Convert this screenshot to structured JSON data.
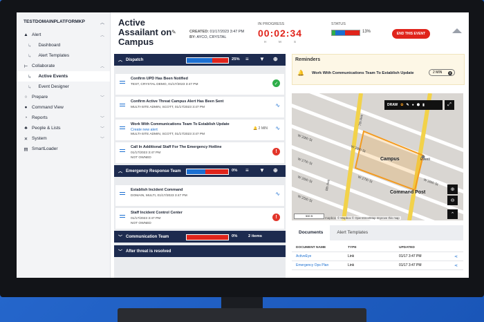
{
  "sidebar": {
    "org": "TESTDOMAINPLATFORMKP",
    "items": [
      {
        "label": "Alert",
        "icon": "warning-icon"
      },
      {
        "label": "Dashboard"
      },
      {
        "label": "Alert Templates"
      },
      {
        "label": "Collaborate",
        "icon": "collaborate-icon"
      },
      {
        "label": "Active Events"
      },
      {
        "label": "Event Designer"
      },
      {
        "label": "Prepare",
        "icon": "prepare-icon"
      },
      {
        "label": "Command View",
        "icon": "location-pin-icon"
      },
      {
        "label": "Reports",
        "icon": "reports-icon"
      },
      {
        "label": "People & Lists",
        "icon": "people-icon"
      },
      {
        "label": "System",
        "icon": "tools-icon"
      },
      {
        "label": "SmartLoader",
        "icon": "smartloader-icon"
      }
    ]
  },
  "header": {
    "title": "Active Assailant on Campus",
    "created_label": "CREATED:",
    "created_value": "01/17/2023 3:47 PM",
    "by_label": "BY:",
    "by_value": "AYCO, CRYSTAL",
    "in_progress_label": "IN PROGRESS",
    "timer": "00:02:34",
    "timer_h": "H",
    "timer_m": "M",
    "timer_s": "S",
    "status_label": "STATUS",
    "status_pct": "13%",
    "status_complete_fraction": 0.13,
    "end_button": "END THIS EVENT"
  },
  "sections": {
    "dispatch": {
      "label": "Dispatch",
      "pct": "25%",
      "progress": {
        "blue": 0.62,
        "red": 0.38
      }
    },
    "ert": {
      "label": "Emergency Response Team",
      "pct": "0%",
      "progress": {
        "blue": 0.45,
        "red": 0.55
      }
    },
    "comm": {
      "label": "Communication Team",
      "pct": "0%",
      "items": "2 items",
      "progress": {
        "red": 1.0
      }
    },
    "after": {
      "label": "After threat is resolved"
    }
  },
  "tasks": [
    {
      "title": "Confirm UPD Has Been Notified",
      "meta": "TEST, CRYSTAL DEMO, 01/17/2023 3:47 PM",
      "status": "done"
    },
    {
      "title": "Confirm Active Threat Campus Alert Has Been Sent",
      "meta": "MULTI-SITE ADMIN, SCOTT, 01/17/2023 3:47 PM",
      "status": "in-progress"
    },
    {
      "title": "Work With Communications Team To Establish Update",
      "link": "Create new alert",
      "meta": "MULTI-SITE ADMIN, SCOTT, 01/17/2023 3:47 PM",
      "reminder": "2 MIN",
      "status": "in-progress"
    },
    {
      "title": "Call In Additional Staff For The Emergency Hotline",
      "meta": "01/17/2023 3:47 PM",
      "meta2": "NOT OWNED",
      "status": "alert"
    },
    {
      "title": "Establish Incident Command",
      "meta": "DOMAIN, MULTI, 01/17/2023 3:47 PM",
      "status": "in-progress"
    },
    {
      "title": "Staff Incident Control Center",
      "meta": "01/17/2023 3:47 PM",
      "meta2": "NOT OWNED",
      "status": "alert"
    }
  ],
  "reminders": {
    "title": "Reminders",
    "text": "Work With Communications Team To Establish Update",
    "pill": "2 MIN"
  },
  "map": {
    "draw_label": "DRAW",
    "campus_label": "Campus",
    "command_post_label": "Command Post",
    "poi_label": "Eventi",
    "streets": [
      "W 29th St",
      "W 28th St",
      "W 27th St",
      "W 26th St",
      "W 25th St",
      "W 27th St",
      "W 26th St",
      "7th Ave",
      "8th Ave"
    ],
    "scale": "500 ft",
    "logo": "mapbox",
    "attribution": "© Mapbox  © OpenStreetMap  Improve this map",
    "colors": {
      "campus": "#f39a1e",
      "road": "#f2d24a",
      "block": "#cfcac4"
    }
  },
  "documents": {
    "tabs": [
      "Documents",
      "Alert Templates"
    ],
    "headers": [
      "DOCUMENT NAME",
      "TYPE",
      "UPDATED"
    ],
    "rows": [
      {
        "name": "ActiveEye",
        "type": "Link",
        "updated": "01/17 3:47 PM"
      },
      {
        "name": "Emergency Ops Plan",
        "type": "Link",
        "updated": "01/17 3:47 PM"
      }
    ]
  },
  "colors": {
    "navy": "#1d2b4f",
    "accent_blue": "#1b6fd1",
    "red": "#e0241b",
    "green": "#2fae4a"
  }
}
